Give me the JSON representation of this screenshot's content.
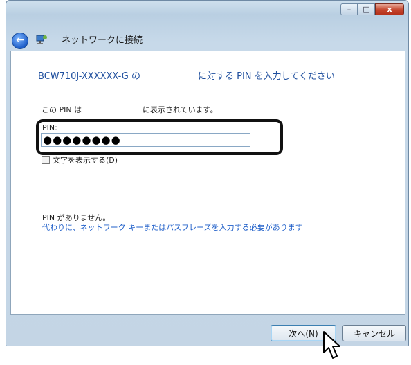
{
  "window": {
    "title": "ネットワークに接続",
    "controls": {
      "minimize": "–",
      "maximize": "□",
      "close": "x"
    }
  },
  "icons": {
    "back": "back-arrow-icon",
    "app": "network-icon",
    "cursor": "mouse-pointer-icon"
  },
  "content": {
    "heading_left": "BCW710J-XXXXXX-G の",
    "heading_right": "に対する PIN を入力してください",
    "pin_hint_left": "この PIN は",
    "pin_hint_right": "に表示されています。",
    "pin_label": "PIN:",
    "pin_value": "●●●●●●●●",
    "show_chars_label": "文字を表示する(D)",
    "no_pin_text": "PIN がありません。",
    "link_text": "代わりに、ネットワーク キーまたはパスフレーズを入力する必要があります"
  },
  "footer": {
    "next_label": "次へ(N)",
    "cancel_label": "キャンセル"
  },
  "colors": {
    "accent": "#1f4f9e",
    "link": "#1f5fc9",
    "close": "#c5452c"
  }
}
